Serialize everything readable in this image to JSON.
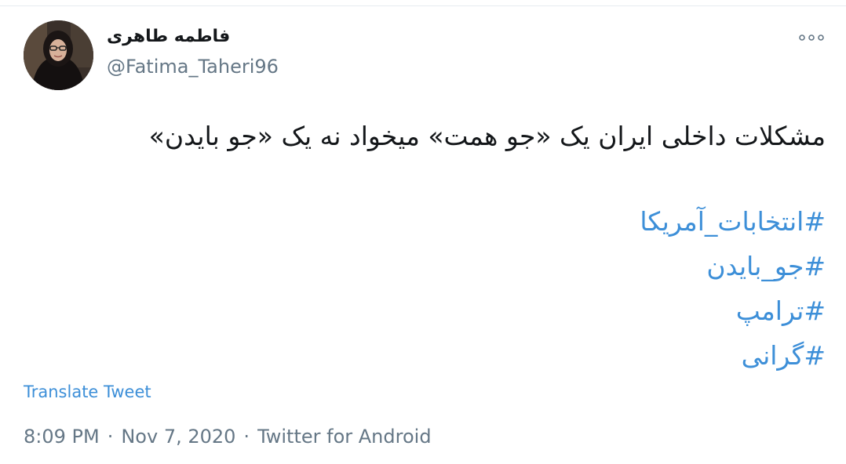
{
  "tweet": {
    "author": {
      "display_name": "فاطمه طاهری",
      "handle": "@Fatima_Taheri96"
    },
    "text": "مشکلات داخلی ایران یک «جو همت» میخواد نه یک «جو بایدن»",
    "hashtags": [
      "#انتخابات_آمریکا",
      "#جو_بایدن",
      "#ترامپ",
      "#گرانی"
    ],
    "translate_label": "Translate Tweet",
    "time": "8:09 PM",
    "separator": "·",
    "date": "Nov 7, 2020",
    "source": "Twitter for Android"
  },
  "icons": {
    "more": "more-horizontal-icon"
  },
  "colors": {
    "link": "#3d8fd8",
    "text": "#14171a",
    "muted": "#657786",
    "divider": "#e6ecf0"
  }
}
